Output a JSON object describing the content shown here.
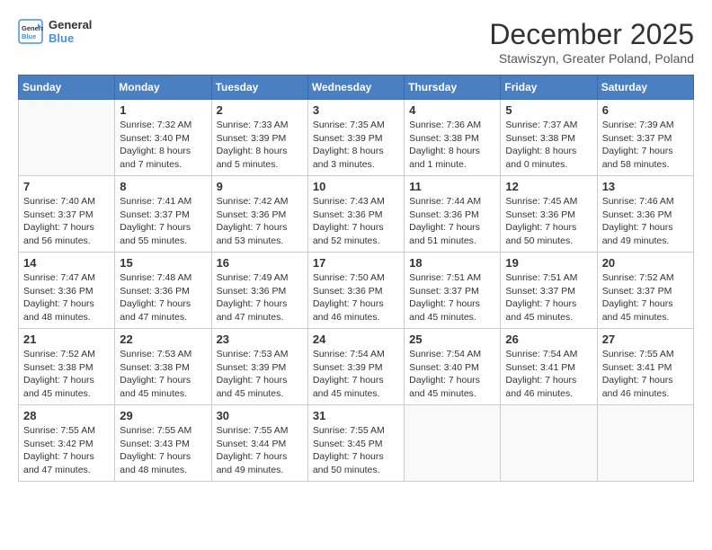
{
  "logo": {
    "line1": "General",
    "line2": "Blue"
  },
  "title": "December 2025",
  "location": "Stawiszyn, Greater Poland, Poland",
  "days_of_week": [
    "Sunday",
    "Monday",
    "Tuesday",
    "Wednesday",
    "Thursday",
    "Friday",
    "Saturday"
  ],
  "weeks": [
    [
      {
        "day": "",
        "info": ""
      },
      {
        "day": "1",
        "info": "Sunrise: 7:32 AM\nSunset: 3:40 PM\nDaylight: 8 hours\nand 7 minutes."
      },
      {
        "day": "2",
        "info": "Sunrise: 7:33 AM\nSunset: 3:39 PM\nDaylight: 8 hours\nand 5 minutes."
      },
      {
        "day": "3",
        "info": "Sunrise: 7:35 AM\nSunset: 3:39 PM\nDaylight: 8 hours\nand 3 minutes."
      },
      {
        "day": "4",
        "info": "Sunrise: 7:36 AM\nSunset: 3:38 PM\nDaylight: 8 hours\nand 1 minute."
      },
      {
        "day": "5",
        "info": "Sunrise: 7:37 AM\nSunset: 3:38 PM\nDaylight: 8 hours\nand 0 minutes."
      },
      {
        "day": "6",
        "info": "Sunrise: 7:39 AM\nSunset: 3:37 PM\nDaylight: 7 hours\nand 58 minutes."
      }
    ],
    [
      {
        "day": "7",
        "info": "Sunrise: 7:40 AM\nSunset: 3:37 PM\nDaylight: 7 hours\nand 56 minutes."
      },
      {
        "day": "8",
        "info": "Sunrise: 7:41 AM\nSunset: 3:37 PM\nDaylight: 7 hours\nand 55 minutes."
      },
      {
        "day": "9",
        "info": "Sunrise: 7:42 AM\nSunset: 3:36 PM\nDaylight: 7 hours\nand 53 minutes."
      },
      {
        "day": "10",
        "info": "Sunrise: 7:43 AM\nSunset: 3:36 PM\nDaylight: 7 hours\nand 52 minutes."
      },
      {
        "day": "11",
        "info": "Sunrise: 7:44 AM\nSunset: 3:36 PM\nDaylight: 7 hours\nand 51 minutes."
      },
      {
        "day": "12",
        "info": "Sunrise: 7:45 AM\nSunset: 3:36 PM\nDaylight: 7 hours\nand 50 minutes."
      },
      {
        "day": "13",
        "info": "Sunrise: 7:46 AM\nSunset: 3:36 PM\nDaylight: 7 hours\nand 49 minutes."
      }
    ],
    [
      {
        "day": "14",
        "info": "Sunrise: 7:47 AM\nSunset: 3:36 PM\nDaylight: 7 hours\nand 48 minutes."
      },
      {
        "day": "15",
        "info": "Sunrise: 7:48 AM\nSunset: 3:36 PM\nDaylight: 7 hours\nand 47 minutes."
      },
      {
        "day": "16",
        "info": "Sunrise: 7:49 AM\nSunset: 3:36 PM\nDaylight: 7 hours\nand 47 minutes."
      },
      {
        "day": "17",
        "info": "Sunrise: 7:50 AM\nSunset: 3:36 PM\nDaylight: 7 hours\nand 46 minutes."
      },
      {
        "day": "18",
        "info": "Sunrise: 7:51 AM\nSunset: 3:37 PM\nDaylight: 7 hours\nand 45 minutes."
      },
      {
        "day": "19",
        "info": "Sunrise: 7:51 AM\nSunset: 3:37 PM\nDaylight: 7 hours\nand 45 minutes."
      },
      {
        "day": "20",
        "info": "Sunrise: 7:52 AM\nSunset: 3:37 PM\nDaylight: 7 hours\nand 45 minutes."
      }
    ],
    [
      {
        "day": "21",
        "info": "Sunrise: 7:52 AM\nSunset: 3:38 PM\nDaylight: 7 hours\nand 45 minutes."
      },
      {
        "day": "22",
        "info": "Sunrise: 7:53 AM\nSunset: 3:38 PM\nDaylight: 7 hours\nand 45 minutes."
      },
      {
        "day": "23",
        "info": "Sunrise: 7:53 AM\nSunset: 3:39 PM\nDaylight: 7 hours\nand 45 minutes."
      },
      {
        "day": "24",
        "info": "Sunrise: 7:54 AM\nSunset: 3:39 PM\nDaylight: 7 hours\nand 45 minutes."
      },
      {
        "day": "25",
        "info": "Sunrise: 7:54 AM\nSunset: 3:40 PM\nDaylight: 7 hours\nand 45 minutes."
      },
      {
        "day": "26",
        "info": "Sunrise: 7:54 AM\nSunset: 3:41 PM\nDaylight: 7 hours\nand 46 minutes."
      },
      {
        "day": "27",
        "info": "Sunrise: 7:55 AM\nSunset: 3:41 PM\nDaylight: 7 hours\nand 46 minutes."
      }
    ],
    [
      {
        "day": "28",
        "info": "Sunrise: 7:55 AM\nSunset: 3:42 PM\nDaylight: 7 hours\nand 47 minutes."
      },
      {
        "day": "29",
        "info": "Sunrise: 7:55 AM\nSunset: 3:43 PM\nDaylight: 7 hours\nand 48 minutes."
      },
      {
        "day": "30",
        "info": "Sunrise: 7:55 AM\nSunset: 3:44 PM\nDaylight: 7 hours\nand 49 minutes."
      },
      {
        "day": "31",
        "info": "Sunrise: 7:55 AM\nSunset: 3:45 PM\nDaylight: 7 hours\nand 50 minutes."
      },
      {
        "day": "",
        "info": ""
      },
      {
        "day": "",
        "info": ""
      },
      {
        "day": "",
        "info": ""
      }
    ]
  ]
}
